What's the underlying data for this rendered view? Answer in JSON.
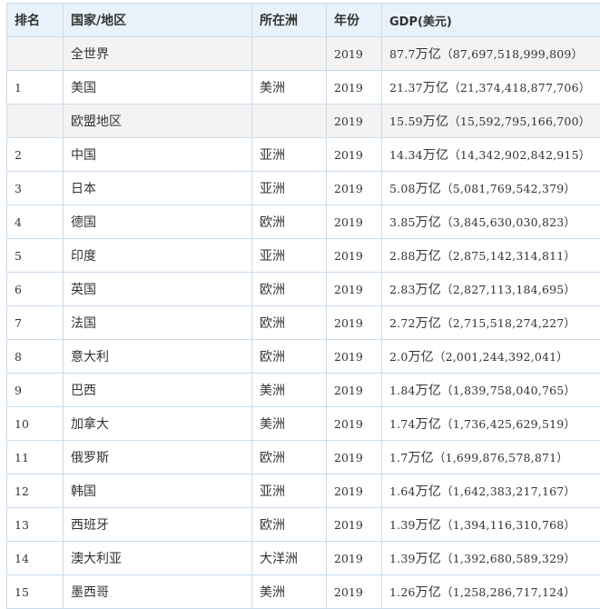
{
  "headers": {
    "rank": "排名",
    "country": "国家/地区",
    "continent": "所在洲",
    "year": "年份",
    "gdp": "GDP(美元)"
  },
  "rows": [
    {
      "rank": "",
      "country": "全世界",
      "continent": "",
      "year": "2019",
      "gdp_num": "87.7",
      "gdp_unit": "万亿",
      "gdp_full": "（87,697,518,999,809）"
    },
    {
      "rank": "1",
      "country": "美国",
      "continent": "美洲",
      "year": "2019",
      "gdp_num": "21.37",
      "gdp_unit": "万亿",
      "gdp_full": "（21,374,418,877,706）"
    },
    {
      "rank": "",
      "country": "欧盟地区",
      "continent": "",
      "year": "2019",
      "gdp_num": "15.59",
      "gdp_unit": "万亿",
      "gdp_full": "（15,592,795,166,700）"
    },
    {
      "rank": "2",
      "country": "中国",
      "continent": "亚洲",
      "year": "2019",
      "gdp_num": "14.34",
      "gdp_unit": "万亿",
      "gdp_full": "（14,342,902,842,915）"
    },
    {
      "rank": "3",
      "country": "日本",
      "continent": "亚洲",
      "year": "2019",
      "gdp_num": "5.08",
      "gdp_unit": "万亿",
      "gdp_full": "（5,081,769,542,379）"
    },
    {
      "rank": "4",
      "country": "德国",
      "continent": "欧洲",
      "year": "2019",
      "gdp_num": "3.85",
      "gdp_unit": "万亿",
      "gdp_full": "（3,845,630,030,823）"
    },
    {
      "rank": "5",
      "country": "印度",
      "continent": "亚洲",
      "year": "2019",
      "gdp_num": "2.88",
      "gdp_unit": "万亿",
      "gdp_full": "（2,875,142,314,811）"
    },
    {
      "rank": "6",
      "country": "英国",
      "continent": "欧洲",
      "year": "2019",
      "gdp_num": "2.83",
      "gdp_unit": "万亿",
      "gdp_full": "（2,827,113,184,695）"
    },
    {
      "rank": "7",
      "country": "法国",
      "continent": "欧洲",
      "year": "2019",
      "gdp_num": "2.72",
      "gdp_unit": "万亿",
      "gdp_full": "（2,715,518,274,227）"
    },
    {
      "rank": "8",
      "country": "意大利",
      "continent": "欧洲",
      "year": "2019",
      "gdp_num": "2.0",
      "gdp_unit": "万亿",
      "gdp_full": "（2,001,244,392,041）"
    },
    {
      "rank": "9",
      "country": "巴西",
      "continent": "美洲",
      "year": "2019",
      "gdp_num": "1.84",
      "gdp_unit": "万亿",
      "gdp_full": "（1,839,758,040,765）"
    },
    {
      "rank": "10",
      "country": "加拿大",
      "continent": "美洲",
      "year": "2019",
      "gdp_num": "1.74",
      "gdp_unit": "万亿",
      "gdp_full": "（1,736,425,629,519）"
    },
    {
      "rank": "11",
      "country": "俄罗斯",
      "continent": "欧洲",
      "year": "2019",
      "gdp_num": "1.7",
      "gdp_unit": "万亿",
      "gdp_full": "（1,699,876,578,871）"
    },
    {
      "rank": "12",
      "country": "韩国",
      "continent": "亚洲",
      "year": "2019",
      "gdp_num": "1.64",
      "gdp_unit": "万亿",
      "gdp_full": "（1,642,383,217,167）"
    },
    {
      "rank": "13",
      "country": "西班牙",
      "continent": "欧洲",
      "year": "2019",
      "gdp_num": "1.39",
      "gdp_unit": "万亿",
      "gdp_full": "（1,394,116,310,768）"
    },
    {
      "rank": "14",
      "country": "澳大利亚",
      "continent": "大洋洲",
      "year": "2019",
      "gdp_num": "1.39",
      "gdp_unit": "万亿",
      "gdp_full": "（1,392,680,589,329）"
    },
    {
      "rank": "15",
      "country": "墨西哥",
      "continent": "美洲",
      "year": "2019",
      "gdp_num": "1.26",
      "gdp_unit": "万亿",
      "gdp_full": "（1,258,286,717,124）"
    }
  ]
}
